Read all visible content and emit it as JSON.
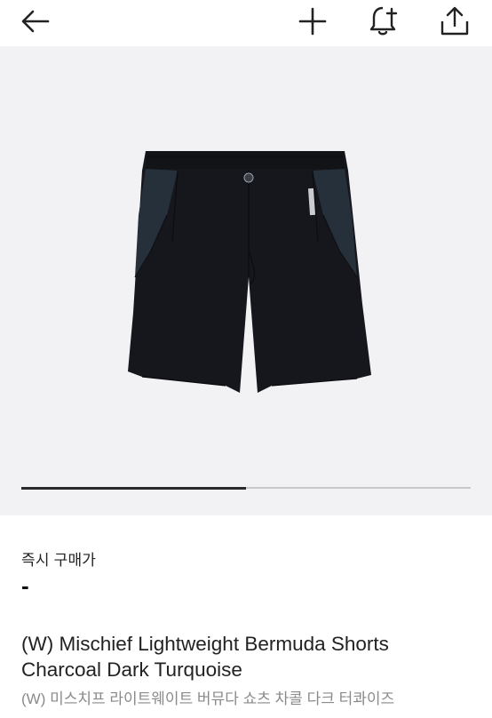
{
  "header": {
    "back_icon": "arrow-left-icon",
    "add_icon": "plus-icon",
    "alert_icon": "bell-plus-icon",
    "share_icon": "share-icon"
  },
  "gallery": {
    "image_subject": "black bermuda shorts with dark turquoise side panels",
    "progress": 0.5
  },
  "price": {
    "label": "즉시 구매가",
    "value": "-"
  },
  "product": {
    "title_line1": "(W) Mischief Lightweight Bermuda Shorts",
    "title_line2": "Charcoal Dark Turquoise",
    "subtitle": "(W) 미스치프 라이트웨이트 버뮤다 쇼츠 차콜 다크 터콰이즈"
  },
  "colors": {
    "image_background": "#f2f2f4",
    "shorts_body": "#15171c",
    "shorts_panel": "#26303b",
    "progress_fill": "#2a2a2a",
    "progress_track": "#c8c8ca",
    "subtitle_gray": "#8a8a8a"
  }
}
